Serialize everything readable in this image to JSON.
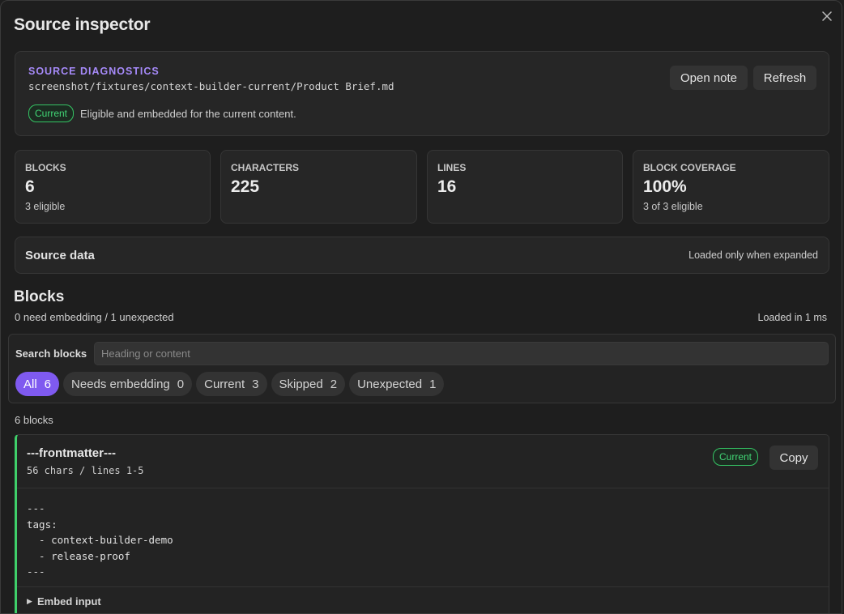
{
  "modal": {
    "title": "Source inspector"
  },
  "diagnostics": {
    "kicker": "SOURCE DIAGNOSTICS",
    "path": "screenshot/fixtures/context-builder-current/Product Brief.md",
    "status_badge": "Current",
    "status_text": "Eligible and embedded for the current content.",
    "open_note_label": "Open note",
    "refresh_label": "Refresh"
  },
  "stats": [
    {
      "label": "BLOCKS",
      "value": "6",
      "sub": "3 eligible"
    },
    {
      "label": "CHARACTERS",
      "value": "225",
      "sub": ""
    },
    {
      "label": "LINES",
      "value": "16",
      "sub": ""
    },
    {
      "label": "BLOCK COVERAGE",
      "value": "100%",
      "sub": "3 of 3 eligible"
    }
  ],
  "source_data": {
    "title": "Source data",
    "note": "Loaded only when expanded"
  },
  "blocks": {
    "title": "Blocks",
    "subtitle": "0 need embedding / 1 unexpected",
    "loaded": "Loaded in 1 ms",
    "search_label": "Search blocks",
    "search_placeholder": "Heading or content",
    "search_value": "",
    "filters": [
      {
        "label": "All",
        "count": "6",
        "active": true
      },
      {
        "label": "Needs embedding",
        "count": "0",
        "active": false
      },
      {
        "label": "Current",
        "count": "3",
        "active": false
      },
      {
        "label": "Skipped",
        "count": "2",
        "active": false
      },
      {
        "label": "Unexpected",
        "count": "1",
        "active": false
      }
    ],
    "count_text": "6 blocks",
    "items": [
      {
        "name": "---frontmatter---",
        "meta": "56 chars / lines 1-5",
        "badge": "Current",
        "copy_label": "Copy",
        "code": "---\ntags:\n  - context-builder-demo\n  - release-proof\n---",
        "embed_label": "Embed input"
      }
    ]
  },
  "colors": {
    "accent": "#7f5af0",
    "kicker": "#a68af9",
    "current_green": "#41d675"
  },
  "icons": {
    "close": "close-icon",
    "disclosure": "triangle-right-icon"
  }
}
